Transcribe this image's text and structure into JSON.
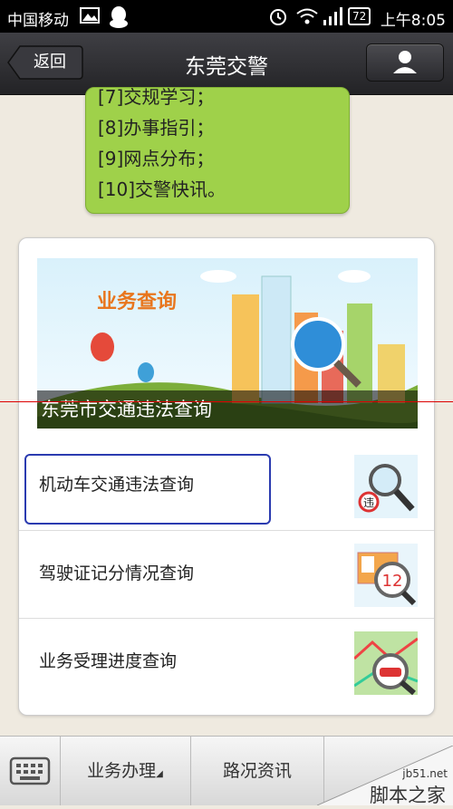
{
  "status_bar": {
    "carrier": "中国移动",
    "battery": "72",
    "time": "上午8:05"
  },
  "header": {
    "back_label": "返回",
    "title": "东莞交警"
  },
  "bubble": {
    "lines": [
      "[7]交规学习；",
      "[8]办事指引；",
      "[9]网点分布；",
      "[10]交警快讯。"
    ]
  },
  "card": {
    "banner_tag": "业务查询",
    "banner_caption": "东莞市交通违法查询",
    "items": [
      {
        "label": "机动车交通违法查询",
        "icon": "magnifier-violation-icon"
      },
      {
        "label": "驾驶证记分情况查询",
        "icon": "license-points-icon"
      },
      {
        "label": "业务受理进度查询",
        "icon": "map-car-icon"
      }
    ],
    "badge_violation": "违",
    "badge_points": "12"
  },
  "bottom_bar": {
    "tabs": [
      "业务办理",
      "路况资讯"
    ]
  },
  "watermark": {
    "site": "jb51.net",
    "name": "脚本之家"
  },
  "colors": {
    "bubble": "#9fd14a",
    "header": "#2e2e32",
    "focus": "#2b3bb0"
  }
}
